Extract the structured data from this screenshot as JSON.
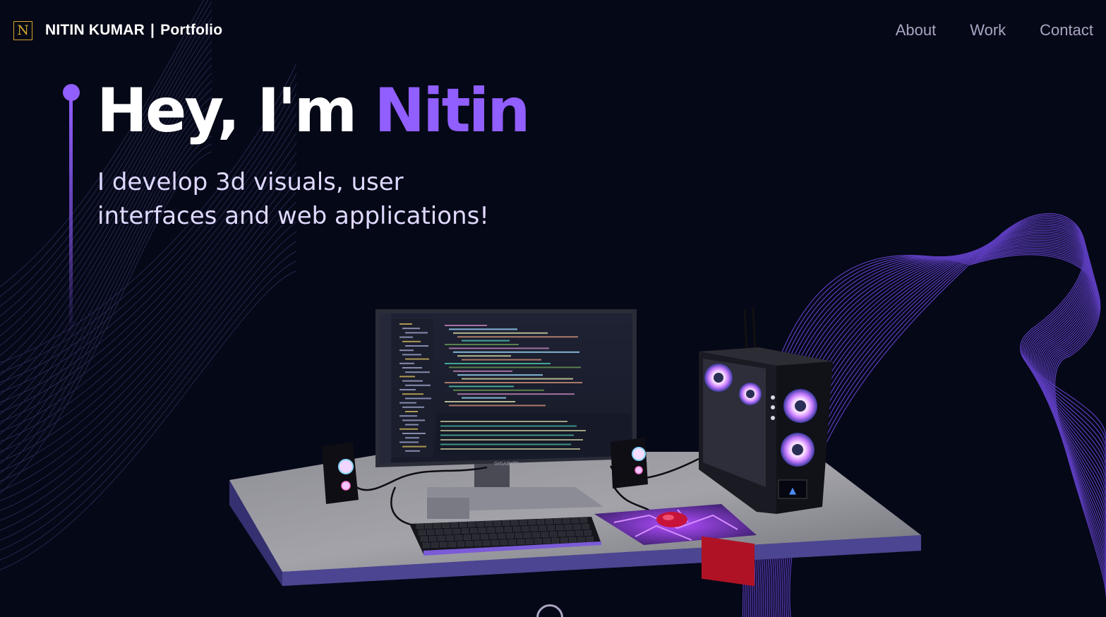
{
  "navbar": {
    "logo_letter": "N",
    "brand_name": "NITIN KUMAR",
    "brand_separator": "|",
    "brand_suffix": "Portfolio",
    "links": [
      {
        "label": "About"
      },
      {
        "label": "Work"
      },
      {
        "label": "Contact"
      }
    ]
  },
  "hero": {
    "greeting": "Hey, I'm ",
    "name": "Nitin",
    "subtitle_line1": "I develop 3d visuals, user",
    "subtitle_line2": "interfaces and web applications!"
  },
  "scene": {
    "monitor_brand": "GIGABYTE"
  },
  "colors": {
    "background": "#050816",
    "accent": "#915eff",
    "nav_text": "#aaa6c3",
    "logo": "#d4a62a"
  },
  "icons": {
    "logo": "n-logo-icon",
    "scroll": "scroll-down-icon"
  }
}
